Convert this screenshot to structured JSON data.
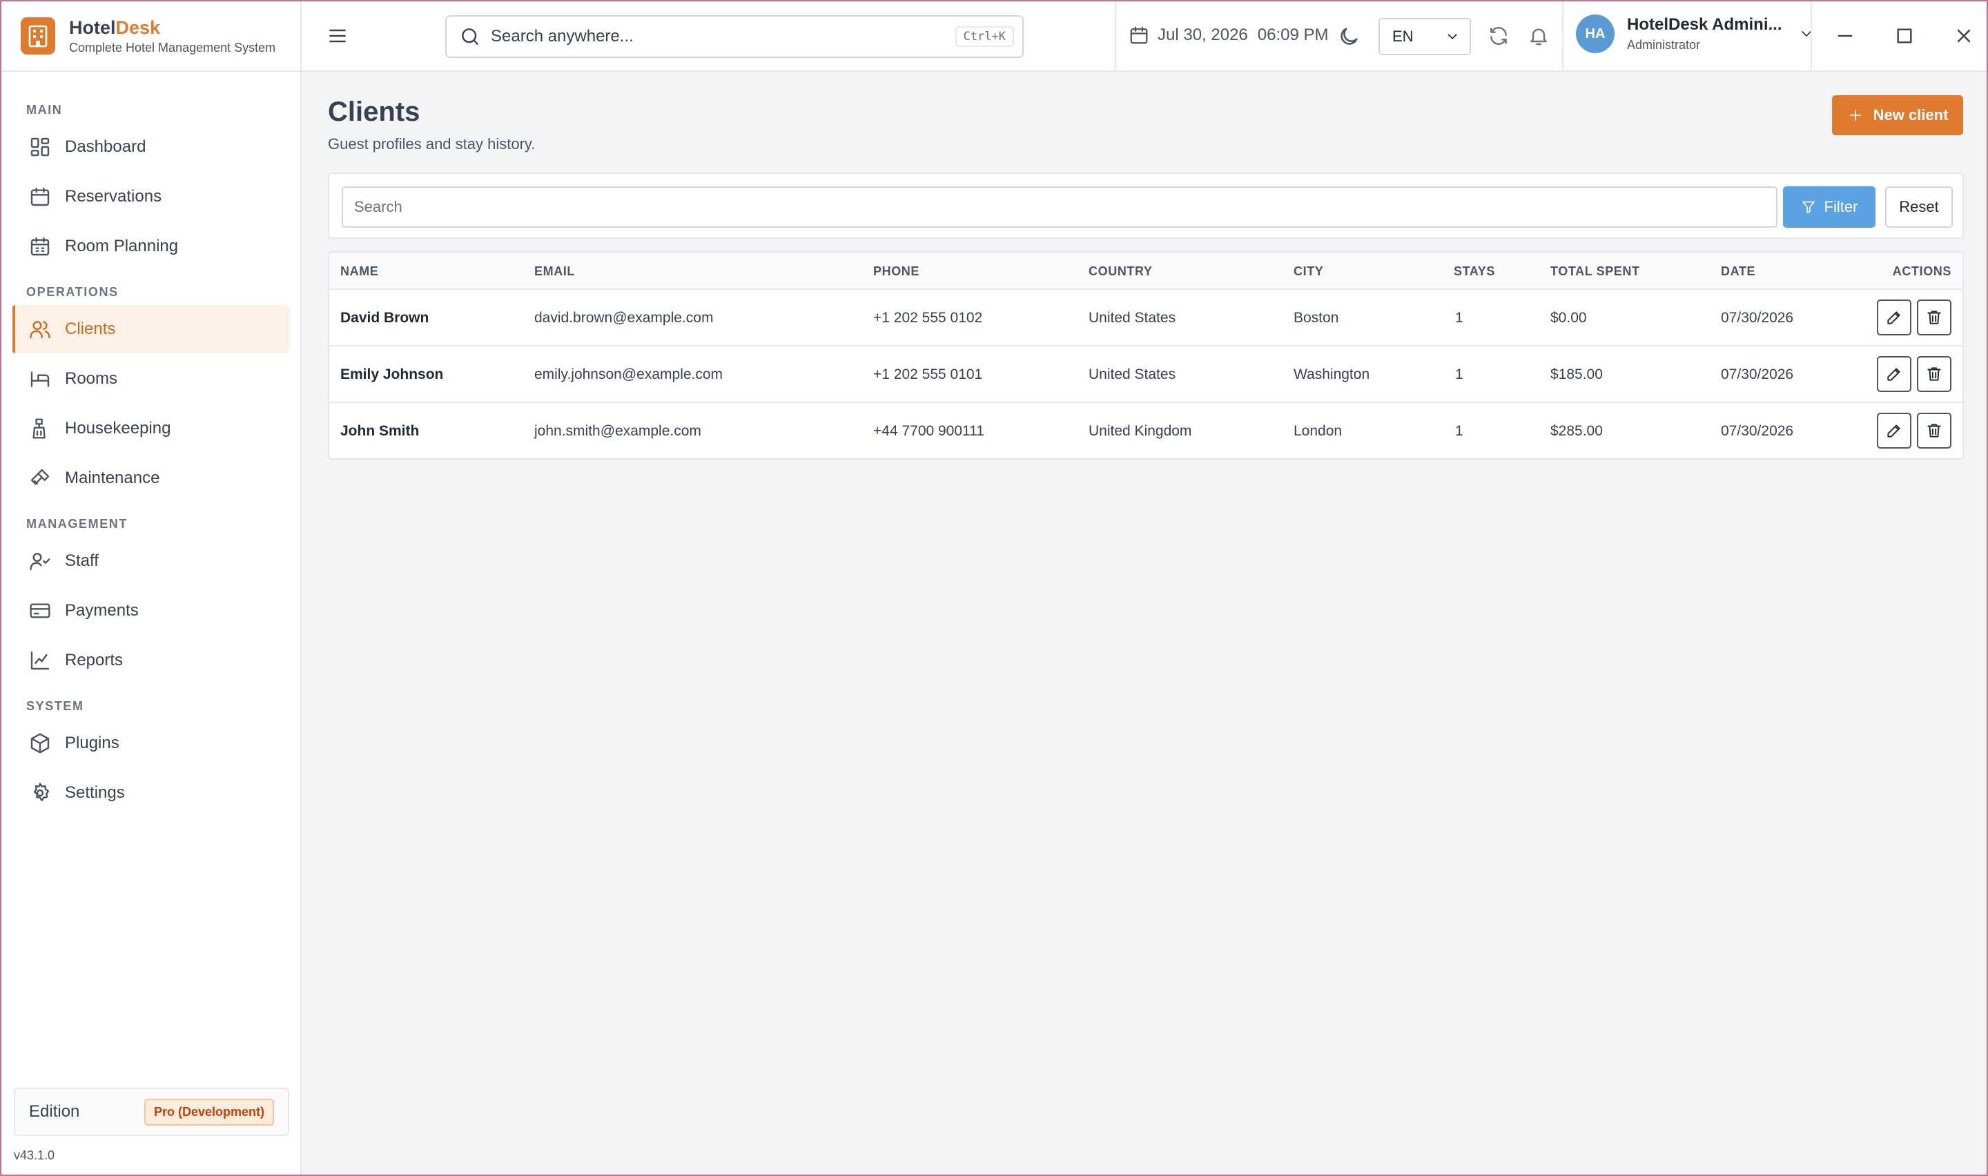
{
  "brand": {
    "name_part1": "Hotel",
    "name_part2": "Desk",
    "tagline": "Complete Hotel Management System"
  },
  "sidebar": {
    "sections": [
      {
        "label": "MAIN",
        "items": [
          {
            "label": "Dashboard",
            "icon": "dashboard-icon"
          },
          {
            "label": "Reservations",
            "icon": "calendar-icon"
          },
          {
            "label": "Room Planning",
            "icon": "calendar-grid-icon"
          }
        ]
      },
      {
        "label": "OPERATIONS",
        "items": [
          {
            "label": "Clients",
            "icon": "users-icon",
            "active": true
          },
          {
            "label": "Rooms",
            "icon": "bed-icon"
          },
          {
            "label": "Housekeeping",
            "icon": "broom-icon"
          },
          {
            "label": "Maintenance",
            "icon": "wrench-icon"
          }
        ]
      },
      {
        "label": "MANAGEMENT",
        "items": [
          {
            "label": "Staff",
            "icon": "user-check-icon"
          },
          {
            "label": "Payments",
            "icon": "credit-card-icon"
          },
          {
            "label": "Reports",
            "icon": "line-chart-icon"
          }
        ]
      },
      {
        "label": "SYSTEM",
        "items": [
          {
            "label": "Plugins",
            "icon": "package-icon"
          },
          {
            "label": "Settings",
            "icon": "gear-icon"
          }
        ]
      }
    ],
    "edition_label": "Edition",
    "edition_badge": "Pro (Development)",
    "version": "v43.1.0"
  },
  "topbar": {
    "search_placeholder": "Search anywhere...",
    "search_shortcut": "Ctrl+K",
    "date": "Jul 30, 2026",
    "time": "06:09 PM",
    "language": "EN",
    "user_initials": "HA",
    "user_name": "HotelDesk Admini...",
    "user_role": "Administrator"
  },
  "main": {
    "title": "Clients",
    "subtitle": "Guest profiles and stay history.",
    "new_button": "New client",
    "filter": {
      "placeholder": "Search",
      "filter_label": "Filter",
      "reset_label": "Reset"
    },
    "table": {
      "headers": [
        "NAME",
        "EMAIL",
        "PHONE",
        "COUNTRY",
        "CITY",
        "STAYS",
        "TOTAL SPENT",
        "DATE",
        "ACTIONS"
      ],
      "rows": [
        {
          "name": "David Brown",
          "email": "david.brown@example.com",
          "phone": "+1 202 555 0102",
          "country": "United States",
          "city": "Boston",
          "stays": "1",
          "total": "$0.00",
          "date": "07/30/2026"
        },
        {
          "name": "Emily Johnson",
          "email": "emily.johnson@example.com",
          "phone": "+1 202 555 0101",
          "country": "United States",
          "city": "Washington",
          "stays": "1",
          "total": "$185.00",
          "date": "07/30/2026"
        },
        {
          "name": "John Smith",
          "email": "john.smith@example.com",
          "phone": "+44 7700 900111",
          "country": "United Kingdom",
          "city": "London",
          "stays": "1",
          "total": "$285.00",
          "date": "07/30/2026"
        }
      ]
    }
  },
  "colors": {
    "accent": "#e07a2e",
    "filter_blue": "#5ba2e2",
    "avatar_blue": "#5b9bd5"
  }
}
